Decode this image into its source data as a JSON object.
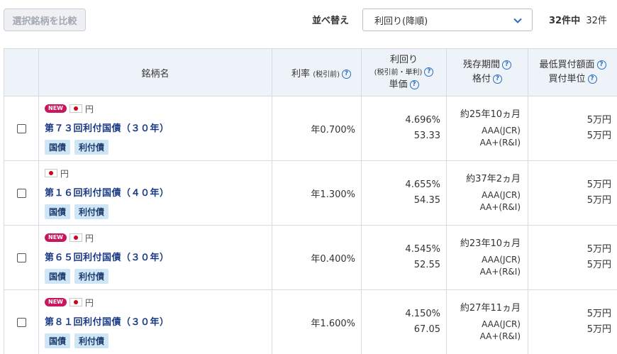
{
  "toolbar": {
    "compare_label": "選択銘柄を比較",
    "sort_label": "並べ替え",
    "sort_value": "利回り(降順)",
    "count_total": "32件中",
    "count_shown": "32件"
  },
  "columns": {
    "name": "銘柄名",
    "rate": "利率",
    "rate_sub": "(税引前)",
    "yield": "利回り",
    "yield_sub": "(税引前・単利)",
    "price": "単価",
    "term": "残存期間",
    "rating": "格付",
    "min_amount": "最低買付額面",
    "unit": "買付単位"
  },
  "chip_labels": {
    "govt": "国債",
    "coupon": "利付債"
  },
  "colors": {
    "accent": "#2a6dbd",
    "new_badge": "#c8175d",
    "chip_bg": "#cfe6f7",
    "bond_name": "#1a3a85"
  },
  "rows": [
    {
      "new": true,
      "new_label": "NEW",
      "currency": "円",
      "name": "第７３回利付国債（３０年）",
      "rate": "年0.700%",
      "yield": "4.696%",
      "price": "53.33",
      "term": "約25年10ヵ月",
      "rating1": "AAA(JCR)",
      "rating2": "AA+(R&I)",
      "min_amount": "5万円",
      "unit": "5万円"
    },
    {
      "new": false,
      "new_label": "",
      "currency": "円",
      "name": "第１６回利付国債（４０年）",
      "rate": "年1.300%",
      "yield": "4.655%",
      "price": "54.35",
      "term": "約37年2ヵ月",
      "rating1": "AAA(JCR)",
      "rating2": "AA+(R&I)",
      "min_amount": "5万円",
      "unit": "5万円"
    },
    {
      "new": true,
      "new_label": "NEW",
      "currency": "円",
      "name": "第６５回利付国債（３０年）",
      "rate": "年0.400%",
      "yield": "4.545%",
      "price": "52.55",
      "term": "約23年10ヵ月",
      "rating1": "AAA(JCR)",
      "rating2": "AA+(R&I)",
      "min_amount": "5万円",
      "unit": "5万円"
    },
    {
      "new": true,
      "new_label": "NEW",
      "currency": "円",
      "name": "第８１回利付国債（３０年）",
      "rate": "年1.600%",
      "yield": "4.150%",
      "price": "67.05",
      "term": "約27年11ヵ月",
      "rating1": "AAA(JCR)",
      "rating2": "AA+(R&I)",
      "min_amount": "5万円",
      "unit": "5万円"
    }
  ]
}
